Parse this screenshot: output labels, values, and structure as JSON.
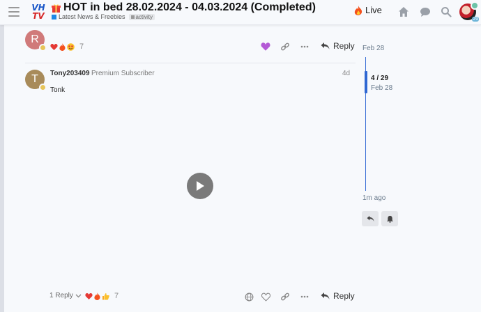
{
  "header": {
    "title": "HOT in bed 28.02.2024 - 04.03.2024 (Completed)",
    "category": "Latest News & Freebies",
    "tag": "activity",
    "live_label": "Live",
    "logo_line1": "VH",
    "logo_line2": "TV",
    "avatar_count": "29",
    "icons": [
      "hamburger-icon",
      "gift-icon",
      "fire-icon",
      "home-icon",
      "chat-icon",
      "search-icon"
    ]
  },
  "post1": {
    "avatar_letter": "R",
    "avatar_color": "#d07a7a",
    "reaction_count": "7",
    "reply_label": "Reply"
  },
  "post2": {
    "avatar_letter": "T",
    "avatar_color": "#a88b5a",
    "username": "Tony203409",
    "user_title": "Premium Subscriber",
    "age": "4d",
    "body": "Tonk",
    "replies_label": "1 Reply",
    "reaction_count": "7",
    "reply_label": "Reply"
  },
  "timeline": {
    "date_top": "Feb 28",
    "position": "4 / 29",
    "date_current": "Feb 28",
    "date_bottom": "1m ago"
  },
  "colors": {
    "accent": "#2f67d2",
    "heart_purple": "#b45ad6"
  }
}
